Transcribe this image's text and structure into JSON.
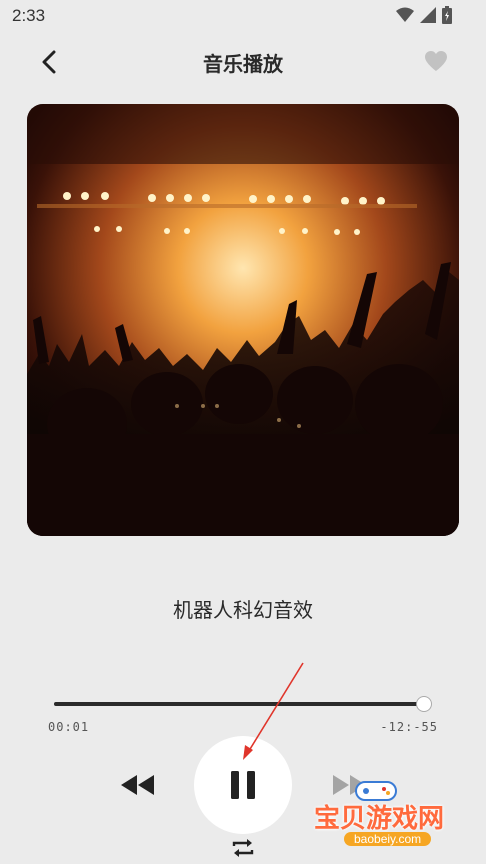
{
  "status_bar": {
    "time": "2:33",
    "icons": [
      "wifi-icon",
      "signal-icon",
      "battery-icon"
    ]
  },
  "header": {
    "title": "音乐播放",
    "back_icon": "chevron-left-icon",
    "favorite_icon": "heart-icon"
  },
  "cover": {
    "image": "concert-crowd-photo"
  },
  "song": {
    "title": "机器人科幻音效"
  },
  "playback": {
    "current_time": "00:01",
    "remaining_time": "-12:-55",
    "progress": 1.0
  },
  "controls": {
    "previous_icon": "rewind-icon",
    "play_state_icon": "pause-icon",
    "next_icon": "fast-forward-icon",
    "repeat_icon": "repeat-icon"
  },
  "watermark": {
    "text": "宝贝游戏网",
    "domain": "baobeiy.com"
  },
  "colors": {
    "background": "#ebebeb",
    "progress_fill": "#2b2b2b",
    "progress_track": "#c7c7c7",
    "watermark": "#ff6a3d",
    "annotation_arrow": "#e0352b"
  }
}
